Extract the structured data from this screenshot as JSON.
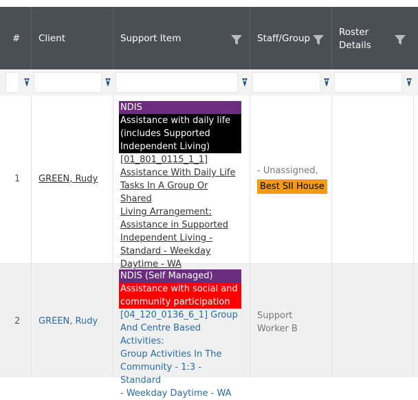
{
  "headers": {
    "num": "#",
    "client": "Client",
    "support_item": "Support Item",
    "staff_group": "Staff/Group",
    "roster_details_line1": "Roster",
    "roster_details_line2": "Details"
  },
  "rows": [
    {
      "num": "1",
      "client": "GREEN, Rudy",
      "funding": "NDIS",
      "funding_color": "#6b2d7e",
      "category": "Assistance with daily life (includes Supported Independent Living)",
      "category_color": "#000000",
      "item_lines": [
        "[01_801_0115_1_1]",
        "Assistance With Daily Life",
        "Tasks In A Group Or Shared",
        "Living Arrangement:",
        "Assistance in Supported",
        "Independent Living -",
        "Standard - Weekday",
        "Daytime - WA"
      ],
      "staff": "- Unassigned,",
      "staff_badge": "Best SII House",
      "staff_badge_color": "#f39c12"
    },
    {
      "num": "2",
      "client": "GREEN, Rudy",
      "funding": "NDIS (Self Managed)",
      "funding_color": "#6b2d7e",
      "category": "Assistance with social and community participation",
      "category_color": "#ff0000",
      "item_lines": [
        "[04_120_0136_6_1] Group",
        "And Centre Based Activities:",
        "Group Activities In The",
        "Community - 1:3 - Standard",
        "- Weekday Daytime - WA"
      ],
      "staff_line1": "Support",
      "staff_line2": "Worker B"
    }
  ]
}
